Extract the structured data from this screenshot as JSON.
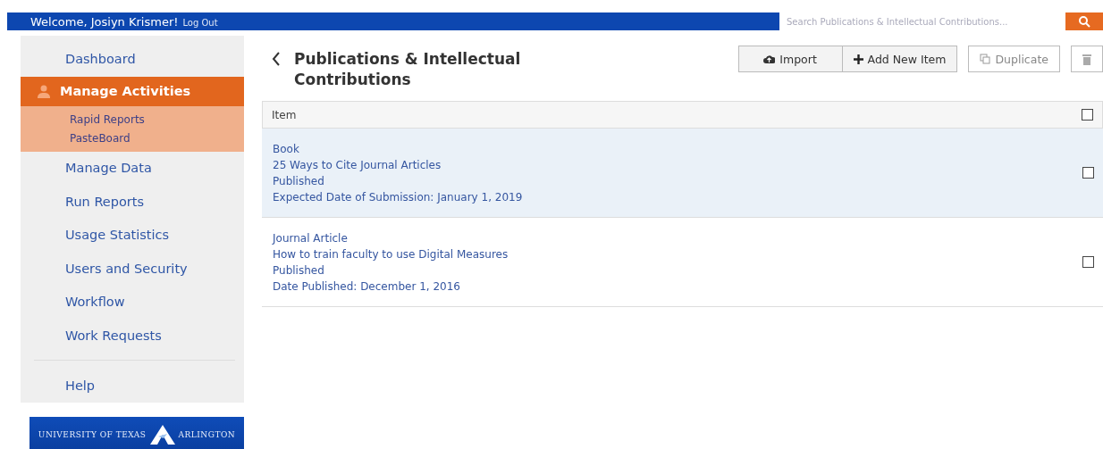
{
  "top_bar": {
    "welcome": "Welcome, Josiyn Krismer!",
    "logout": "Log Out",
    "search": {
      "placeholder": "Search Publications & Intellectual Contributions..."
    }
  },
  "sidebar": {
    "items": [
      {
        "label": "Dashboard",
        "selected": false
      },
      {
        "label": "Manage Activities",
        "selected": true,
        "children": [
          {
            "label": "Rapid Reports"
          },
          {
            "label": "PasteBoard"
          }
        ]
      },
      {
        "label": "Manage Data",
        "selected": false
      },
      {
        "label": "Run Reports",
        "selected": false
      },
      {
        "label": "Usage Statistics",
        "selected": false
      },
      {
        "label": "Users and Security",
        "selected": false
      },
      {
        "label": "Workflow",
        "selected": false
      },
      {
        "label": "Work Requests",
        "selected": false
      }
    ],
    "footer_items": [
      {
        "label": "Help",
        "selected": false
      }
    ],
    "logo": {
      "left": "UNIVERSITY OF TEXAS",
      "right": "ARLINGTON"
    }
  },
  "page": {
    "title": "Publications & Intellectual Contributions",
    "buttons": [
      {
        "label": "Import",
        "kind": "import"
      },
      {
        "label": "Add New Item",
        "kind": "add"
      }
    ],
    "secondary_buttons": [
      {
        "label": "Duplicate",
        "kind": "duplicate"
      },
      {
        "kind": "delete"
      }
    ]
  },
  "table": {
    "columns": [
      {
        "label": "Item",
        "checked": false
      }
    ],
    "rows": [
      {
        "selected": true,
        "checked": false,
        "lines": [
          "Book",
          "25 Ways to Cite Journal Articles",
          "Published",
          "Expected Date of Submission: January 1, 2019"
        ]
      },
      {
        "selected": false,
        "checked": false,
        "lines": [
          "Journal Article",
          "How to train faculty to use Digital Measures",
          "Published",
          "Date Published: December 1, 2016"
        ]
      }
    ]
  }
}
